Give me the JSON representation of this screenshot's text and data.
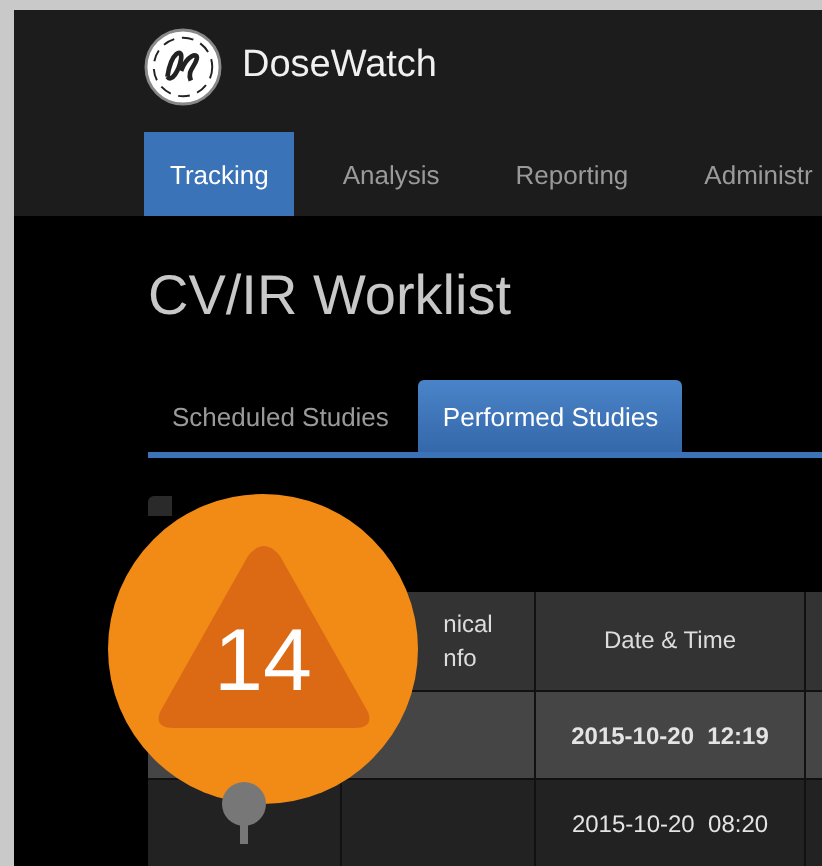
{
  "app": {
    "name": "DoseWatch"
  },
  "nav": [
    {
      "label": "Tracking",
      "selected": true
    },
    {
      "label": "Analysis",
      "selected": false
    },
    {
      "label": "Reporting",
      "selected": false
    },
    {
      "label": "Administr",
      "selected": false
    }
  ],
  "page_title": "CV/IR Worklist",
  "study_tabs": [
    {
      "label": "Scheduled Studies",
      "selected": false
    },
    {
      "label": "Performed Studies",
      "selected": true
    }
  ],
  "table": {
    "columns": [
      {
        "lines": [
          "nical",
          "nfo"
        ]
      },
      {
        "lines": [
          "Date & Time"
        ]
      }
    ],
    "rows": [
      {
        "selected": true,
        "marker": false,
        "date": "2015-10-20",
        "time": "12:19"
      },
      {
        "selected": false,
        "marker": true,
        "date": "2015-10-20",
        "time": "08:20"
      }
    ]
  },
  "alert_badge": {
    "count": "14"
  }
}
